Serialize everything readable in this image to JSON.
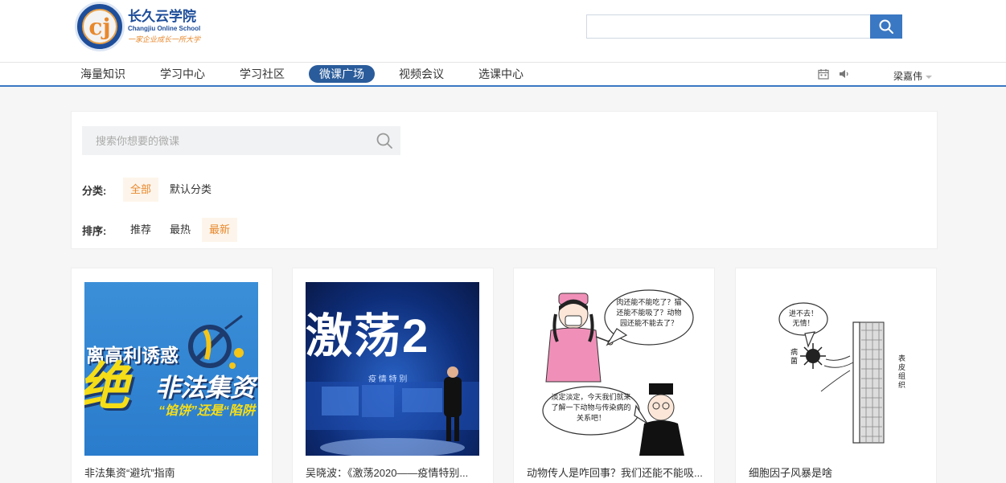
{
  "logo": {
    "cn": "长久云学院",
    "en": "Changjiu Online School",
    "slogan": "一家企业成长一所大学"
  },
  "search_top": {
    "value": "",
    "placeholder": ""
  },
  "nav": {
    "items": [
      {
        "label": "海量知识"
      },
      {
        "label": "学习中心"
      },
      {
        "label": "学习社区"
      },
      {
        "label": "微课广场"
      },
      {
        "label": "视频会议"
      },
      {
        "label": "选课中心"
      }
    ],
    "active": "微课广场",
    "user": "梁嘉伟"
  },
  "panel": {
    "search_placeholder": "搜索你想要的微课",
    "category_label": "分类:",
    "categories": [
      "全部",
      "默认分类"
    ],
    "category_active": "全部",
    "sort_label": "排序:",
    "sorts": [
      "推荐",
      "最热",
      "最新"
    ],
    "sort_active": "最新"
  },
  "cards": [
    {
      "title": "非法集资“避坑”指南",
      "thumb_text": {
        "line1": "离高利诱惑",
        "big": "绝",
        "line2": "非法集资",
        "line3": "“馅饼”还是“陷阱"
      }
    },
    {
      "title": "吴晓波：《激荡2020——疫情特别...",
      "thumb_text": {
        "big": "激荡2",
        "sub": "疫  情  特  别"
      }
    },
    {
      "title": "动物传人是咋回事？我们还能不能吸...",
      "thumb_text": {
        "bubble1": "肉还能不能吃了？猫还能不能吸了？动物园还能不能去了？",
        "bubble2": "淡定淡定，今天我们就来了解一下动物与传染病的关系吧！"
      }
    },
    {
      "title": "细胞因子风暴是啥",
      "thumb_text": {
        "bubble": "进不去！无情！",
        "left": "病菌",
        "right": "表皮组织"
      }
    }
  ],
  "colors": {
    "brand_blue": "#3a78c3",
    "nav_active": "#2a5c9b",
    "accent_orange": "#e8882c"
  }
}
